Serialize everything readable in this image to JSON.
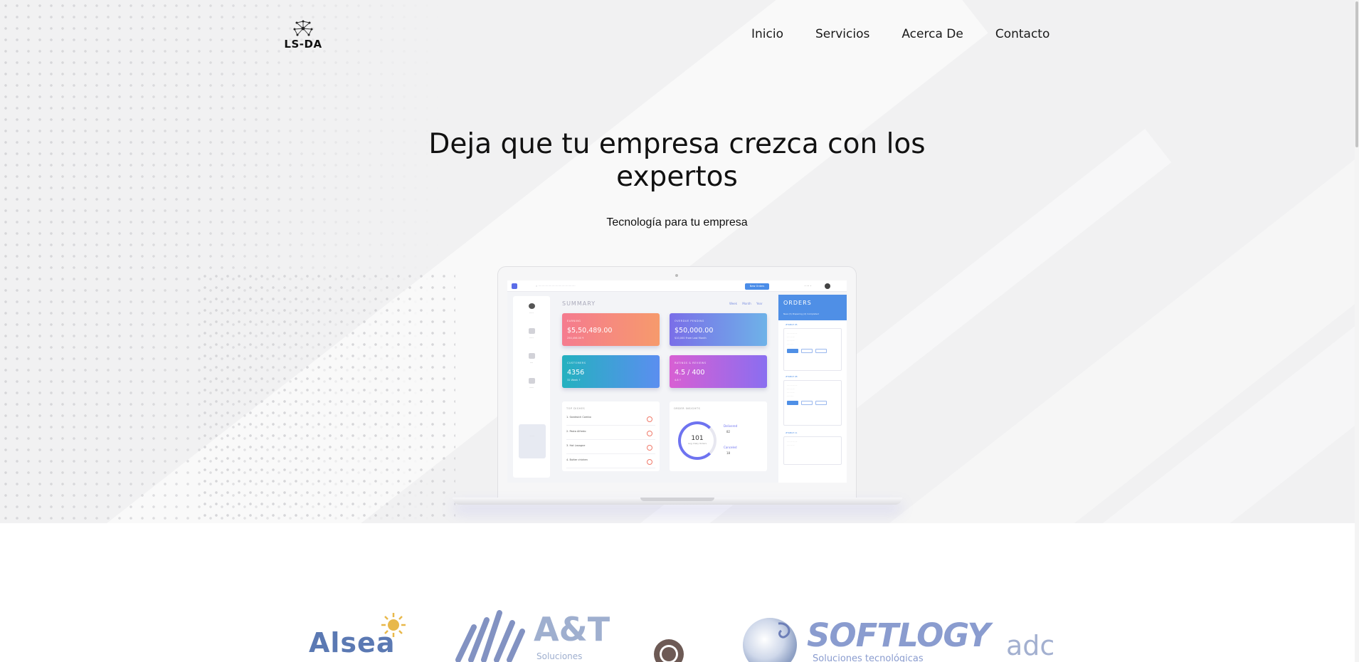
{
  "brand": {
    "name": "LS-DA",
    "logo_icon": "network-nodes-icon"
  },
  "nav": {
    "items": [
      {
        "label": "Inicio"
      },
      {
        "label": "Servicios"
      },
      {
        "label": "Acerca De"
      },
      {
        "label": "Contacto"
      }
    ]
  },
  "hero": {
    "headline": "Deja que tu empresa crezca con los expertos",
    "subtitle": "Tecnología para tu empresa"
  },
  "dashboard": {
    "summary_label": "SUMMARY",
    "period_tabs": "Week Month Year",
    "topbar_button": "New Orders",
    "cards": [
      {
        "label": "EARNING",
        "value": "$5,50,489.00",
        "sub": "250,456.00 ₹"
      },
      {
        "label": "OVERDUE PENDING",
        "value": "$50,000.00",
        "sub": "$10,000 From Last Month"
      },
      {
        "label": "CUSTOMERS",
        "value": "4356",
        "sub": "32 Week ↑"
      },
      {
        "label": "RATINGS & REVIEWS",
        "value": "4.5 / 400",
        "sub": "4.8 ↑"
      }
    ],
    "top_dishes_label": "TOP DISHES",
    "top_dishes": [
      "1. Sandwich Combo",
      "2. Pasta Alfredo",
      "3. Hot Lasagne",
      "4. Butter chicken"
    ],
    "order_insights_label": "ORDER INSIGHTS",
    "gauge_value": "101",
    "gauge_caption": "Avg. Daily Orders",
    "delivered_label": "Delivered",
    "delivered_value": "82",
    "canceled_label": "Canceled",
    "canceled_value": "18",
    "orders_title": "ORDERS",
    "orders_tabs": "New (3)   Preparing (2)   Completed",
    "order_tables": [
      "#TABLE 05",
      "#TABLE 08",
      "#TABLE 11"
    ]
  },
  "partners": [
    {
      "name": "Alsea"
    },
    {
      "name": "A&T",
      "sub": "Soluciones"
    },
    {
      "name": "SOFTLOGY",
      "sub": "Soluciones tecnológicas"
    },
    {
      "name": "adc"
    }
  ],
  "colors": {
    "hero_bg": "#f1f1f2",
    "card_earning": "#f57b8f",
    "card_pending": "#7a6ee8",
    "card_customers": "#24b1bf",
    "card_ratings": "#d85fd3",
    "orders_header": "#4f8fe6"
  }
}
